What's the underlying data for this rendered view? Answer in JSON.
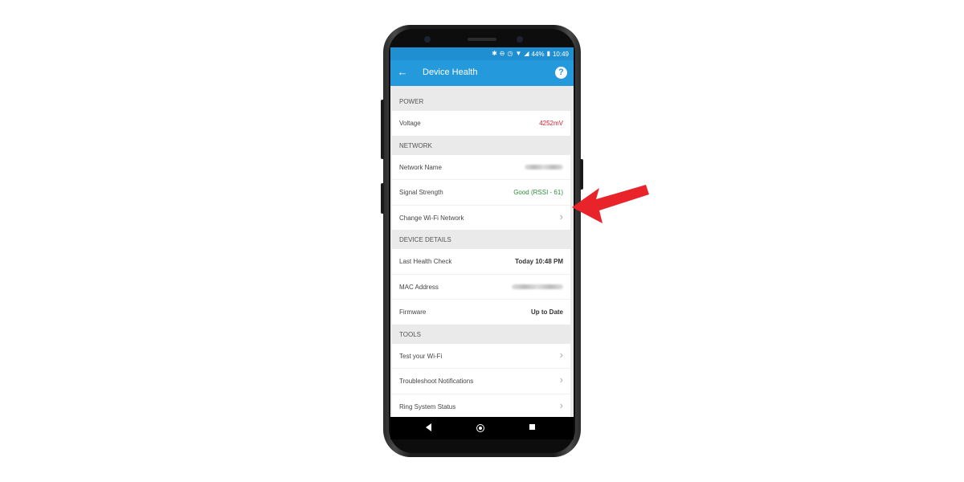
{
  "statusbar": {
    "battery": "44%",
    "time": "10:49"
  },
  "appbar": {
    "title": "Device Health",
    "help": "?"
  },
  "sections": {
    "power": {
      "title": "POWER",
      "rows": [
        {
          "label": "Voltage",
          "value": "4252mV"
        }
      ]
    },
    "network": {
      "title": "NETWORK",
      "rows": [
        {
          "label": "Network Name"
        },
        {
          "label": "Signal Strength",
          "value": "Good (RSSI - 61)"
        },
        {
          "label": "Change Wi-Fi Network"
        }
      ]
    },
    "device": {
      "title": "DEVICE DETAILS",
      "rows": [
        {
          "label": "Last Health Check",
          "value": "Today 10:48 PM"
        },
        {
          "label": "MAC Address"
        },
        {
          "label": "Firmware",
          "value": "Up to Date"
        }
      ]
    },
    "tools": {
      "title": "TOOLS",
      "rows": [
        {
          "label": "Test your Wi-Fi"
        },
        {
          "label": "Troubleshoot Notifications"
        },
        {
          "label": "Ring System Status"
        }
      ]
    }
  },
  "icons": {
    "back": "arrow-left-icon",
    "help": "help-icon",
    "chevron": "chevron-right-icon",
    "annotation": "red-arrow-icon"
  },
  "colors": {
    "appbar": "#2499dc",
    "voltage": "#d0232e",
    "signal": "#2e8f3a",
    "annotation_arrow": "#e8232a"
  }
}
